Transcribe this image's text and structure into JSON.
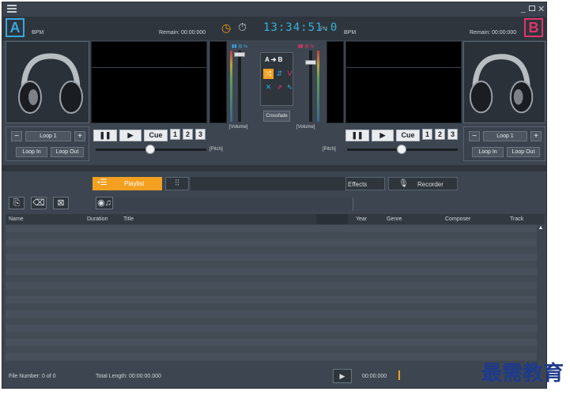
{
  "window": {
    "menu_icon": "hamburger-icon",
    "controls": [
      "minimize-icon",
      "maximize-icon",
      "close-icon"
    ]
  },
  "deck_a": {
    "letter": "A",
    "bpm_label": "BPM",
    "remain_label": "Remain: 00:00:000",
    "loop_label": "Loop 1",
    "loop_in": "Loop In",
    "loop_out": "Loop Out",
    "cue_label": "Cue",
    "hotcues": [
      "1",
      "2",
      "3"
    ],
    "pitch_label": "[Pitch]",
    "volume_label": "[Volume]",
    "minus": "−",
    "plus": "+"
  },
  "deck_b": {
    "letter": "B",
    "bpm_label": "BPM",
    "remain_label": "Remain: 00:00:000",
    "loop_label": "Loop 1",
    "loop_in": "Loop In",
    "loop_out": "Loop Out",
    "cue_label": "Cue",
    "hotcues": [
      "1",
      "2",
      "3"
    ],
    "pitch_label": "[Pitch]",
    "volume_label": "[Volume]",
    "minus": "−",
    "plus": "+"
  },
  "clock": {
    "time": "13:34:51.0",
    "suffix": "PM"
  },
  "mixer": {
    "ab_label": "A ➔ B",
    "crossfade_label": "Crossfade",
    "transition_icons": [
      "fade-cross-icon",
      "fade-up-icon",
      "fade-v-icon",
      "fade-x-icon",
      "fade-arrows-icon",
      "fade-corner-icon"
    ]
  },
  "tabs": {
    "playlist": "Playlist",
    "effects": "Effects",
    "recorder": "Recorder"
  },
  "table": {
    "columns": [
      "Name",
      "Duration",
      "Title",
      "Year",
      "Genre",
      "Composer",
      "Track"
    ]
  },
  "footer": {
    "file_number": "File Number: 0 of 0",
    "total_length": "Total Length: 00:00:00.000",
    "position": "00:00:000"
  },
  "watermark": "最需教育",
  "colors": {
    "deck_a": "#39a7e0",
    "deck_b": "#e0366a",
    "accent": "#f3a021",
    "clock": "#3ab0d8"
  }
}
